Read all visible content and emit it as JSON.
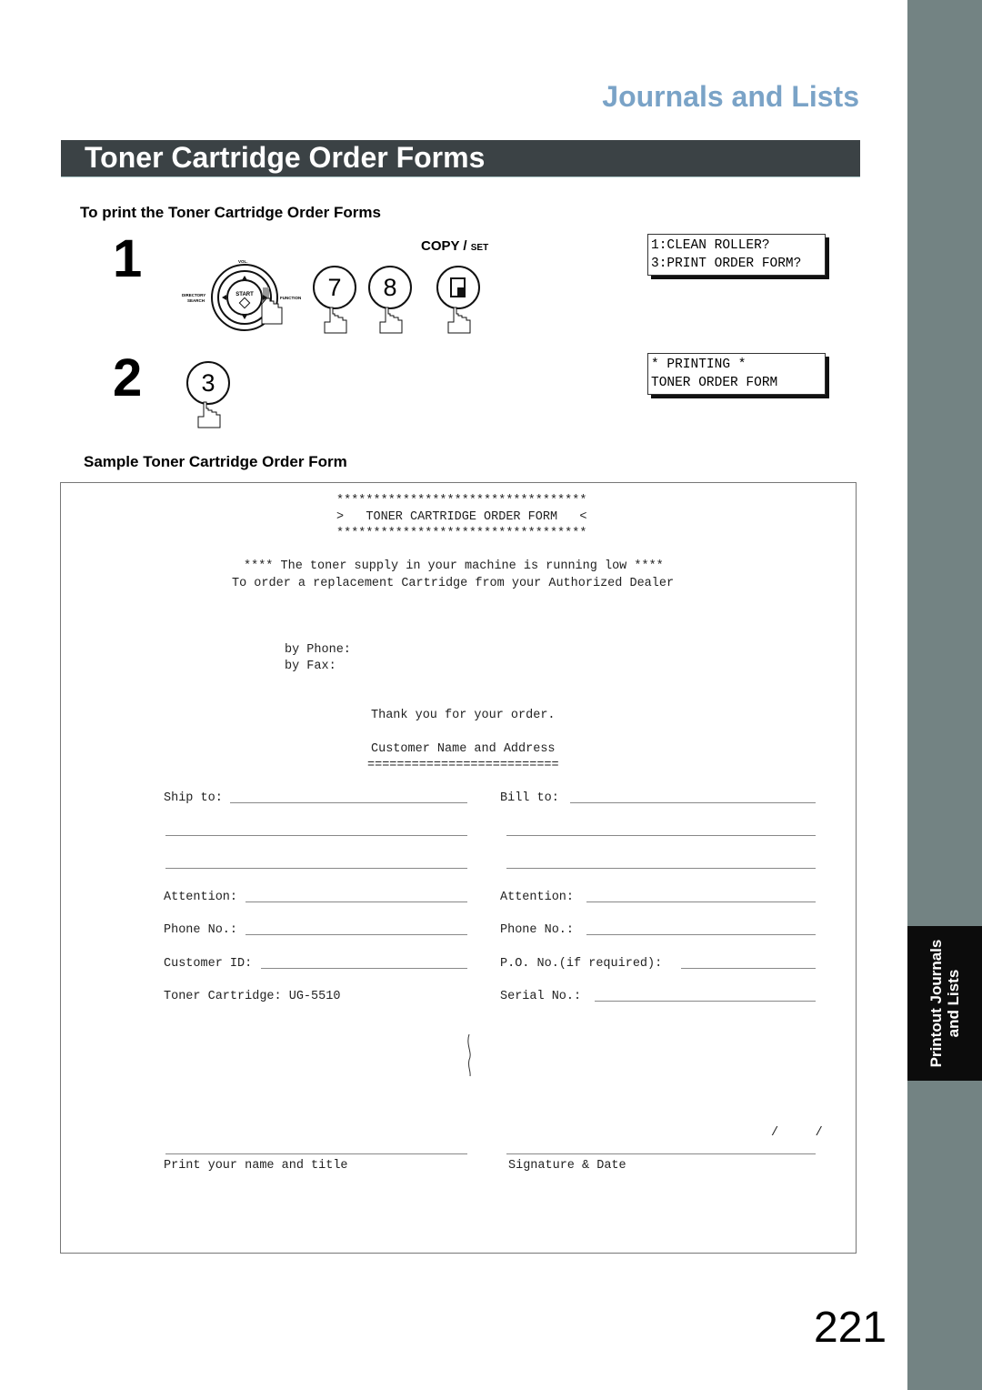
{
  "header": {
    "section_title": "Journals and Lists",
    "page_title": "Toner Cartridge Order Forms"
  },
  "side_tab": {
    "label_line1": "Printout Journals",
    "label_line2": "and Lists"
  },
  "instructions": {
    "heading": "To print the Toner Cartridge Order Forms",
    "steps": [
      {
        "number": "1",
        "keys": [
          "FUNCTION",
          "7",
          "8",
          "COPY / SET"
        ],
        "copy_label_main": "COPY /",
        "copy_label_small": "SET",
        "nav_pad": {
          "top": "VOL.",
          "left": "DIRECTORY SEARCH",
          "center": "START",
          "right": "FUNCTION"
        },
        "key_7": "7",
        "key_8": "8",
        "display": [
          "1:CLEAN ROLLER?",
          "3:PRINT ORDER FORM?"
        ]
      },
      {
        "number": "2",
        "key": "3",
        "display": [
          "* PRINTING *",
          "TONER ORDER FORM"
        ]
      }
    ]
  },
  "sample": {
    "heading": "Sample Toner Cartridge Order Form",
    "stars": "**********************************",
    "form_title": ">   TONER CARTRIDGE ORDER FORM   <",
    "notice_line1": "**** The toner supply in your machine is running low ****",
    "notice_line2": "To order a replacement Cartridge from your Authorized Dealer",
    "by_phone": "by Phone:",
    "by_fax": "by Fax:",
    "thanks": "Thank you for your order.",
    "customer_heading": "Customer Name and Address",
    "customer_rule": "==========================",
    "left": {
      "ship_to": "Ship to:",
      "attention": "Attention:",
      "phone": "Phone No.:",
      "customer_id": "Customer ID:",
      "toner": "Toner Cartridge: UG-5510",
      "print_name": "Print your name and title"
    },
    "right": {
      "bill_to": "Bill to:",
      "attention": "Attention:",
      "phone": "Phone No.:",
      "po": "P.O. No.(if required):",
      "serial": "Serial No.:",
      "date_slashes": "/     /",
      "signature": "Signature & Date"
    }
  },
  "page_number": "221"
}
